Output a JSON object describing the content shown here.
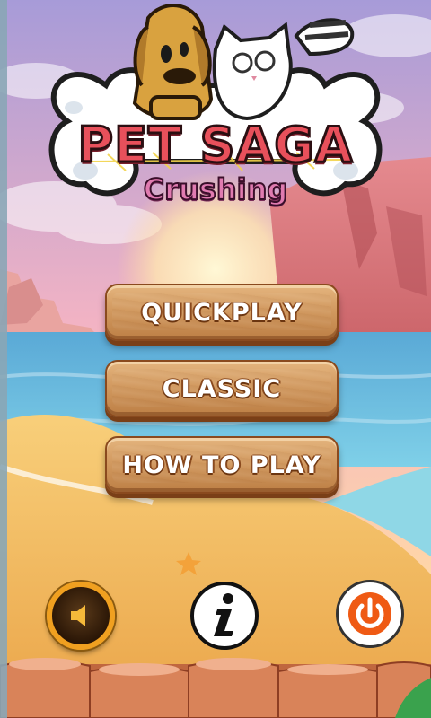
{
  "logo": {
    "title": "PET SAGA",
    "subtitle": "Crushing"
  },
  "menu": {
    "quickplay": "QUICKPLAY",
    "classic": "CLASSIC",
    "how_to_play": "HOW TO PLAY"
  },
  "controls": {
    "sound_icon": "speaker-icon",
    "info_icon": "info-icon",
    "power_icon": "power-icon"
  },
  "colors": {
    "title_fill": "#e8505b",
    "subtitle_fill": "#e07bb0",
    "button_wood": "#d29a60",
    "power_orange": "#ef5a14"
  }
}
